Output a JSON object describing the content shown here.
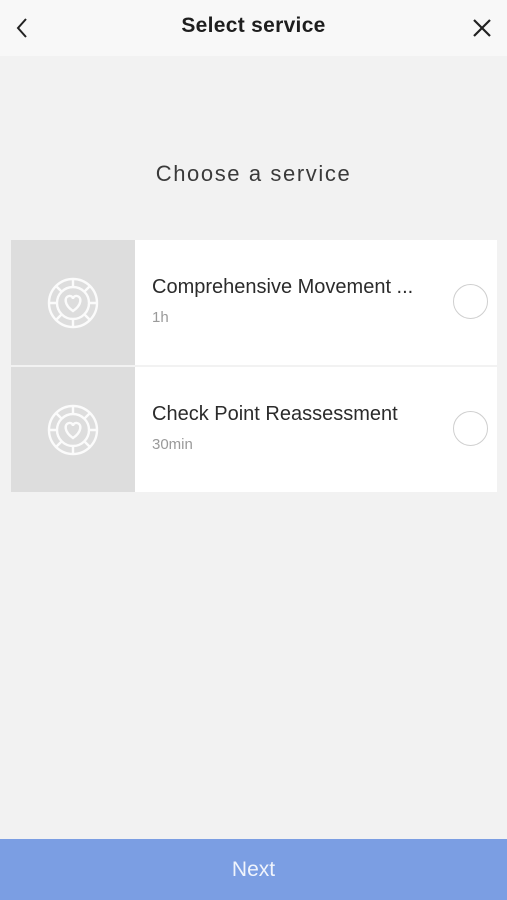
{
  "header": {
    "title": "Select service",
    "back_icon": "chevron-left-icon",
    "close_icon": "close-icon"
  },
  "main": {
    "section_title": "Choose a service",
    "services": [
      {
        "name": "Comprehensive Movement ...",
        "duration": "1h",
        "thumbnail_icon": "heart-flower-logo-icon",
        "selected": false
      },
      {
        "name": "Check Point Reassessment",
        "duration": "30min",
        "thumbnail_icon": "heart-flower-logo-icon",
        "selected": false
      }
    ]
  },
  "footer": {
    "next_label": "Next"
  },
  "colors": {
    "background": "#f2f2f2",
    "header_bg": "#f8f8f8",
    "accent": "#7b9ee3",
    "thumbnail_bg": "#dddddd"
  }
}
